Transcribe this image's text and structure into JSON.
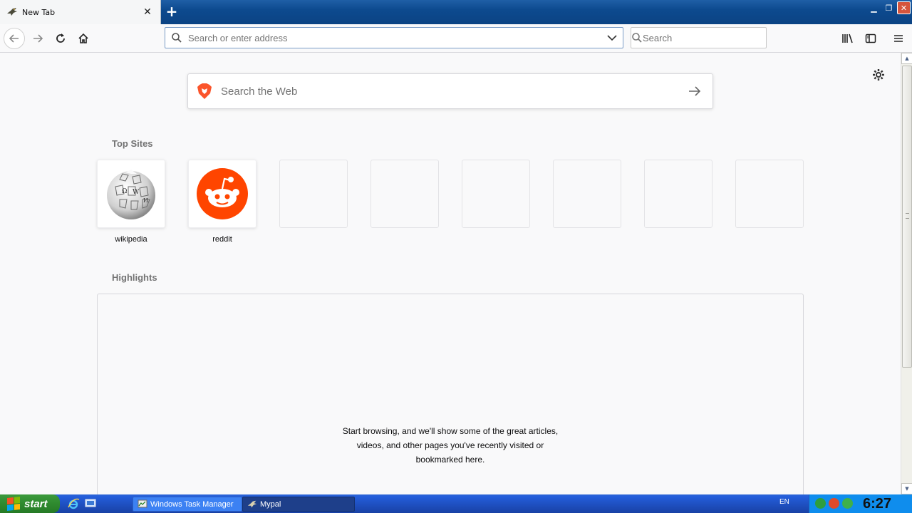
{
  "browser": {
    "tab": {
      "title": "New Tab",
      "favicon": "mypal-bird-icon"
    },
    "window_controls": [
      "minimize-icon",
      "restore-icon",
      "close-icon"
    ],
    "urlbar": {
      "placeholder": "Search or enter address",
      "value": ""
    },
    "searchbar": {
      "placeholder": "Search",
      "value": ""
    },
    "toolbar_icons": [
      "library-icon",
      "sidebar-icon",
      "menu-icon"
    ]
  },
  "newtab": {
    "websearch": {
      "placeholder": "Search the Web",
      "engine_icon": "brave-lion-icon"
    },
    "top_sites_title": "Top Sites",
    "top_sites": [
      {
        "label": "wikipedia",
        "icon": "wikipedia-globe-icon"
      },
      {
        "label": "reddit",
        "icon": "reddit-alien-icon"
      },
      {
        "label": ""
      },
      {
        "label": ""
      },
      {
        "label": ""
      },
      {
        "label": ""
      },
      {
        "label": ""
      },
      {
        "label": ""
      }
    ],
    "highlights_title": "Highlights",
    "highlights_message": "Start browsing, and we'll show some of the great articles, videos, and other pages you've recently visited or bookmarked here."
  },
  "taskbar": {
    "start_label": "start",
    "tasks": [
      {
        "label": "Windows Task Manager"
      },
      {
        "label": "Mypal"
      }
    ],
    "language": "EN",
    "clock": "6:27"
  },
  "colors": {
    "titlebar": "#0d4a8f",
    "reddit_orange": "#ff4500",
    "brave_orange": "#fb542b",
    "taskbar_blue": "#245edb",
    "start_green": "#2f8a2f"
  }
}
